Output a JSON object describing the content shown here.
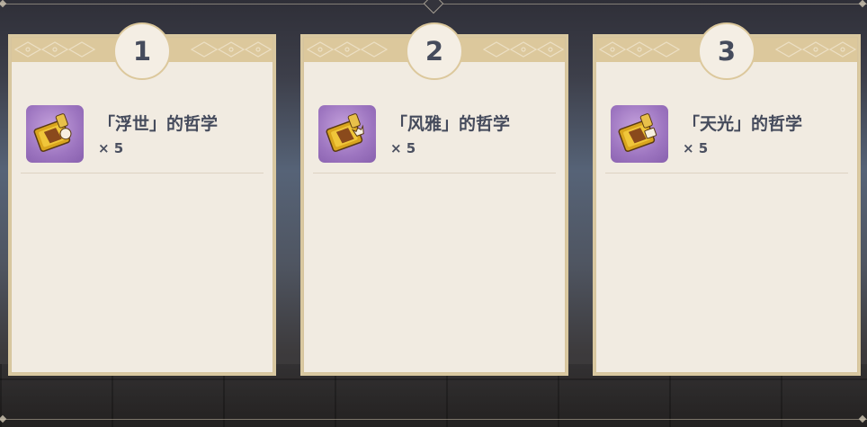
{
  "cards": [
    {
      "number": "1",
      "item": {
        "name": "「浮世」的哲学",
        "count": "× 5",
        "icon": "talent-book-icon"
      }
    },
    {
      "number": "2",
      "item": {
        "name": "「风雅」的哲学",
        "count": "× 5",
        "icon": "talent-book-icon"
      }
    },
    {
      "number": "3",
      "item": {
        "name": "「天光」的哲学",
        "count": "× 5",
        "icon": "talent-book-icon"
      }
    }
  ],
  "colors": {
    "card_background": "#f1ebe1",
    "card_frame": "#d9c8a0",
    "text": "#454b5c",
    "icon_background": "#9d75c0"
  }
}
